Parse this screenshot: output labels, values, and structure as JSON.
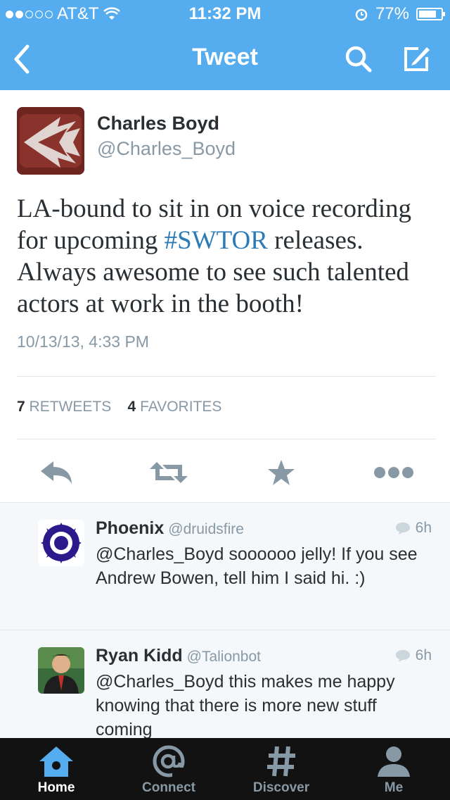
{
  "status_bar": {
    "carrier": "AT&T",
    "time": "11:32 PM",
    "battery": "77%"
  },
  "nav": {
    "title": "Tweet",
    "back_icon": "chevron-left-icon",
    "search_icon": "search-icon",
    "compose_icon": "compose-icon"
  },
  "tweet": {
    "author_name": "Charles Boyd",
    "author_handle": "@Charles_Boyd",
    "text_before": "LA-bound to sit in on voice recording for upcoming ",
    "hashtag": "#SWTOR",
    "text_after": " releases. Always awesome to see such talented actors at work in the booth!",
    "timestamp": "10/13/13, 4:33 PM",
    "retweets_count": "7",
    "retweets_label": "RETWEETS",
    "favorites_count": "4",
    "favorites_label": "FAVORITES"
  },
  "replies": [
    {
      "name": "Phoenix",
      "handle": "@druidsfire",
      "time": "6h",
      "text": "@Charles_Boyd soooooo jelly! If you see Andrew Bowen, tell him I said hi. :)"
    },
    {
      "name": "Ryan Kidd",
      "handle": "@Talionbot",
      "time": "6h",
      "text": "@Charles_Boyd this makes me happy knowing that there is more new stuff coming"
    }
  ],
  "tabs": [
    {
      "label": "Home",
      "icon": "home-icon"
    },
    {
      "label": "Connect",
      "icon": "at-icon"
    },
    {
      "label": "Discover",
      "icon": "hash-icon"
    },
    {
      "label": "Me",
      "icon": "person-icon"
    }
  ],
  "colors": {
    "brand": "#55acee",
    "tab_bar": "#121212",
    "hashtag": "#2b7bb9",
    "muted": "#8899a6"
  }
}
